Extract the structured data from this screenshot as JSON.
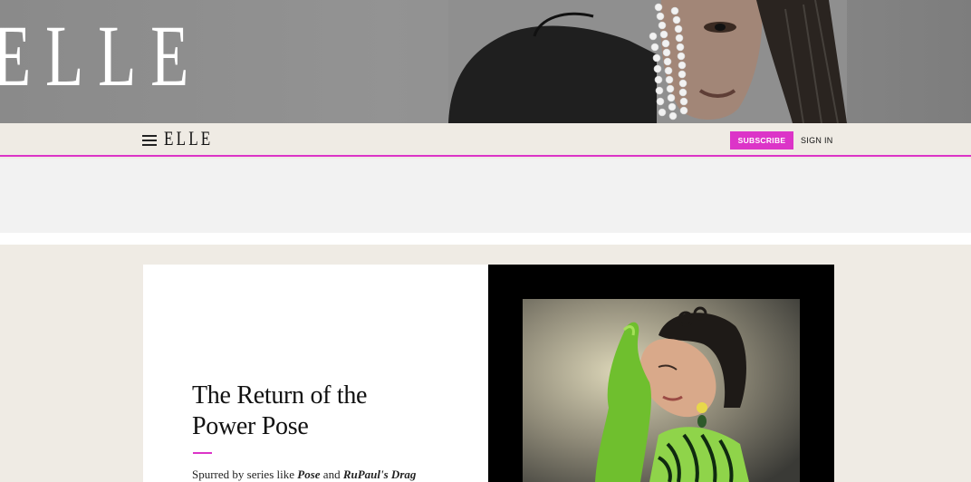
{
  "hero": {
    "logo": "ELLE"
  },
  "nav": {
    "logo": "ELLE",
    "subscribe_label": "SUBSCRIBE",
    "signin_label": "SIGN IN"
  },
  "article": {
    "headline_line1": "The Return of the",
    "headline_line2": "Power Pose",
    "dek_prefix": "Spurred by series like ",
    "dek_pose": "Pose",
    "dek_and": " and ",
    "dek_drag": "RuPaul's Drag"
  },
  "colors": {
    "accent": "#dc34c8",
    "background": "#efebe4"
  }
}
